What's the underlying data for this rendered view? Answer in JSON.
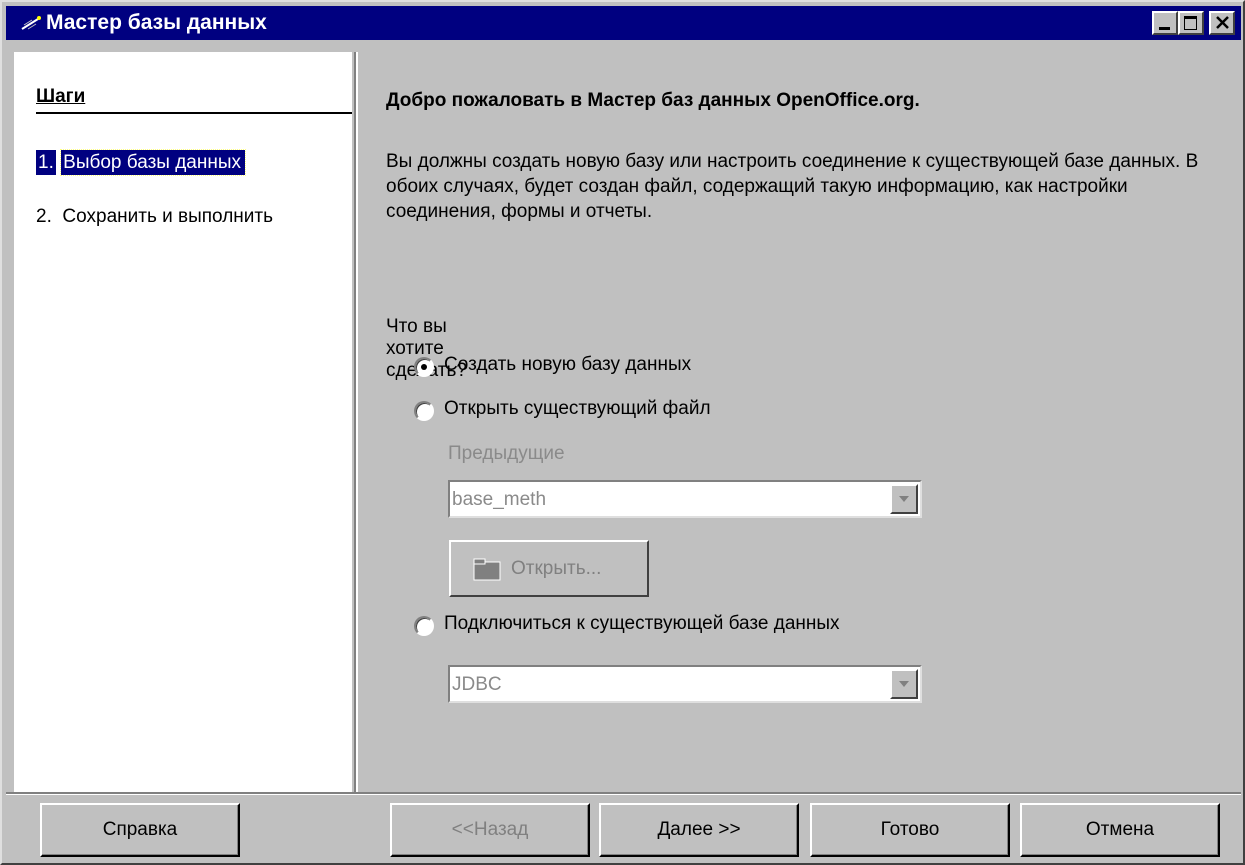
{
  "window": {
    "title": "Мастер базы данных"
  },
  "steps": {
    "title": "Шаги",
    "items": [
      {
        "num": "1.",
        "label": "Выбор базы данных"
      },
      {
        "num": "2.",
        "label": "Сохранить и выполнить"
      }
    ]
  },
  "main": {
    "welcome": "Добро пожаловать в Мастер баз данных OpenOffice.org.",
    "intro": "Вы должны создать новую базу или настроить соединение к существующей базе данных. В обоих случаях, будет создан файл, содержащий такую информацию, как настройки соединения, формы и отчеты.",
    "question": "Что вы хотите сделать?",
    "options": [
      {
        "label": "Создать новую базу данных",
        "checked": true
      },
      {
        "label": "Открыть существующий файл",
        "checked": false
      },
      {
        "label": "Подключиться к существующей базе данных",
        "checked": false
      }
    ],
    "recent_label": "Предыдущие",
    "recent_value": "base_meth",
    "open_button": "Открыть...",
    "connection_value": "JDBC"
  },
  "buttons": {
    "help": "Справка",
    "back": "<<Назад",
    "next": "Далее >>",
    "finish": "Готово",
    "cancel": "Отмена"
  }
}
